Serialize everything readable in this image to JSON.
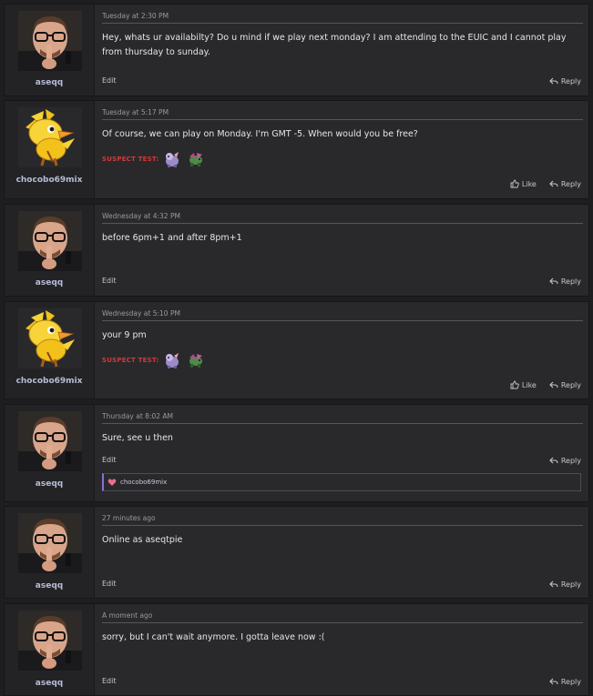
{
  "posts": [
    {
      "author": "aseqq",
      "date": "Tuesday at 2:30 PM",
      "text": "Hey, whats ur availabilty? Do u mind if we play next monday? I am attending to the EUIC and I cannot play from thursday to sunday.",
      "edit": "Edit",
      "reply": "Reply"
    },
    {
      "author": "chocobo69mix",
      "date": "Tuesday at 5:17 PM",
      "text": "Of course, we can play on Monday. I'm GMT -5. When would you be free?",
      "suspect_label": "SUSPECT TEST:",
      "like": "Like",
      "reply": "Reply"
    },
    {
      "author": "aseqq",
      "date": "Wednesday at 4:32 PM",
      "text": "before 6pm+1 and after 8pm+1",
      "edit": "Edit",
      "reply": "Reply"
    },
    {
      "author": "chocobo69mix",
      "date": "Wednesday at 5:10 PM",
      "text": "your 9 pm",
      "suspect_label": "SUSPECT TEST:",
      "like": "Like",
      "reply": "Reply"
    },
    {
      "author": "aseqq",
      "date": "Thursday at 8:02 AM",
      "text": "Sure, see u then",
      "edit": "Edit",
      "reply": "Reply",
      "liked_by": "chocobo69mix"
    },
    {
      "author": "aseqq",
      "date": "27 minutes ago",
      "text": "Online as aseqtpie",
      "edit": "Edit",
      "reply": "Reply"
    },
    {
      "author": "aseqq",
      "date": "A moment ago",
      "text": "sorry, but I can't wait anymore. I gotta leave now :(",
      "edit": "Edit",
      "reply": "Reply"
    }
  ],
  "colors": {
    "suspect": "#d23a3a",
    "username": "#b8bcd6",
    "accent": "#8a6fd1"
  },
  "icons": {
    "reply": "reply-arrow-icon",
    "like": "thumbs-up-icon",
    "liked": "heart-icon"
  }
}
